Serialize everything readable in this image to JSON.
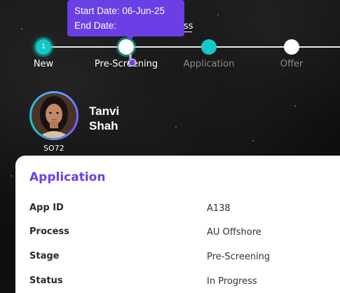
{
  "stepper": {
    "steps": [
      {
        "label": "New",
        "number": "1",
        "state": "done"
      },
      {
        "label": "Pre-Screening",
        "state": "current"
      },
      {
        "label": "Application",
        "state": "upcoming-teal"
      },
      {
        "label": "Offer",
        "state": "upcoming"
      }
    ],
    "tooltip": {
      "start_date": "Start Date: 06-Jun-25",
      "end_date": "End Date:"
    },
    "peek_text": "ss"
  },
  "profile": {
    "first_name": "Tanvi",
    "last_name": "Shah",
    "id": "SO72"
  },
  "application": {
    "title": "Application",
    "rows": [
      {
        "label": "App ID",
        "value": "A138"
      },
      {
        "label": "Process",
        "value": "AU Offshore"
      },
      {
        "label": "Stage",
        "value": "Pre-Screening"
      },
      {
        "label": "Status",
        "value": "In Progress"
      }
    ]
  },
  "colors": {
    "accent_purple": "#6a3fe6",
    "accent_teal": "#14c8c8",
    "background": "#151515"
  }
}
